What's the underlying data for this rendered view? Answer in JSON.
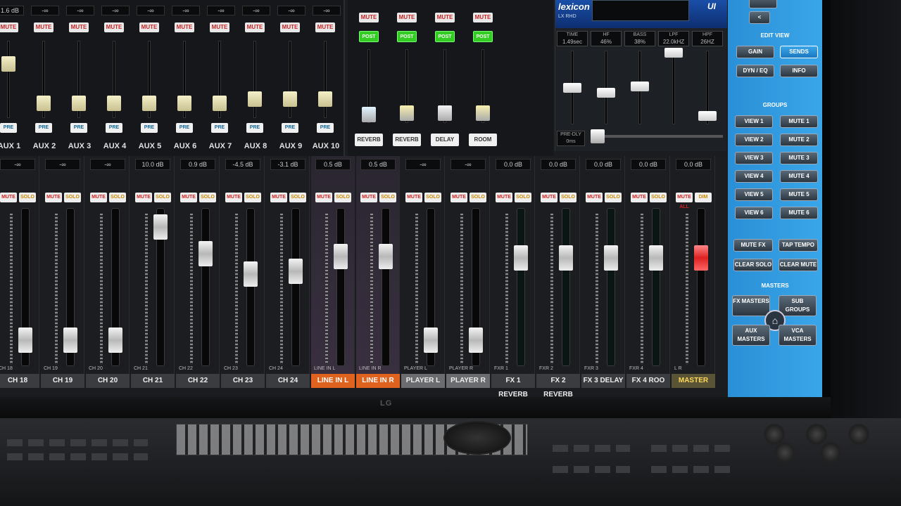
{
  "aux_section": {
    "strips": [
      {
        "value": "1.6 dB",
        "mute": "MUTE",
        "pre": "PRE",
        "name": "AUX 1"
      },
      {
        "value": "-∞",
        "mute": "MUTE",
        "pre": "PRE",
        "name": "AUX 2"
      },
      {
        "value": "-∞",
        "mute": "MUTE",
        "pre": "PRE",
        "name": "AUX 3"
      },
      {
        "value": "-∞",
        "mute": "MUTE",
        "pre": "PRE",
        "name": "AUX 4"
      },
      {
        "value": "-∞",
        "mute": "MUTE",
        "pre": "PRE",
        "name": "AUX 5"
      },
      {
        "value": "-∞",
        "mute": "MUTE",
        "pre": "PRE",
        "name": "AUX 6"
      },
      {
        "value": "-∞",
        "mute": "MUTE",
        "pre": "PRE",
        "name": "AUX 7"
      },
      {
        "value": "-∞",
        "mute": "MUTE",
        "pre": "PRE",
        "name": "AUX 8"
      },
      {
        "value": "-∞",
        "mute": "MUTE",
        "pre": "PRE",
        "name": "AUX 9"
      },
      {
        "value": "-∞",
        "mute": "MUTE",
        "pre": "PRE",
        "name": "AUX 10"
      }
    ]
  },
  "fx_section": {
    "strips": [
      {
        "mute": "MUTE",
        "post": "POST",
        "button": "REVERB"
      },
      {
        "mute": "MUTE",
        "post": "POST",
        "button": "REVERB"
      },
      {
        "mute": "MUTE",
        "post": "POST",
        "button": "DELAY"
      },
      {
        "mute": "MUTE",
        "post": "POST",
        "button": "ROOM"
      }
    ]
  },
  "lexicon": {
    "brand": "lexicon",
    "model": "LX RHD",
    "badge": "UI",
    "params": [
      {
        "name": "TIME",
        "value": "1.49sec"
      },
      {
        "name": "HF",
        "value": "46%"
      },
      {
        "name": "BASS",
        "value": "38%"
      },
      {
        "name": "LPF",
        "value": "22.0kHZ"
      },
      {
        "name": "HPF",
        "value": "26HZ"
      }
    ],
    "predelay_name": "PRE-DLY",
    "predelay_value": "0ms"
  },
  "panel": {
    "edit_view_label": "EDIT VIEW",
    "gain": "GAIN",
    "sends": "SENDS",
    "dyn_eq": "DYN / EQ",
    "info": "INFO",
    "groups_label": "GROUPS",
    "views": [
      "VIEW 1",
      "VIEW 2",
      "VIEW 3",
      "VIEW 4",
      "VIEW 5",
      "VIEW 6"
    ],
    "mutes": [
      "MUTE 1",
      "MUTE 2",
      "MUTE 3",
      "MUTE 4",
      "MUTE 5",
      "MUTE 6"
    ],
    "mute_fx": "MUTE FX",
    "tap_tempo": "TAP TEMPO",
    "clear_solo": "CLEAR SOLO",
    "clear_mute": "CLEAR MUTE",
    "masters_label": "MASTERS",
    "fx_masters": "FX MASTERS",
    "sub_groups": "SUB GROUPS",
    "aux_masters": "AUX MASTERS",
    "vca_masters": "VCA MASTERS"
  },
  "channels": [
    {
      "db": "-∞",
      "mute": "MUTE",
      "solo": "SOLO",
      "label": "CH 18",
      "name": "CH 18",
      "kind": "ch",
      "level": 0.1
    },
    {
      "db": "-∞",
      "mute": "MUTE",
      "solo": "SOLO",
      "label": "CH 19",
      "name": "CH 19",
      "kind": "ch",
      "level": 0.1
    },
    {
      "db": "-∞",
      "mute": "MUTE",
      "solo": "SOLO",
      "label": "CH 20",
      "name": "CH 20",
      "kind": "ch",
      "level": 0.1
    },
    {
      "db": "10.0 dB",
      "mute": "MUTE",
      "solo": "SOLO",
      "label": "CH 21",
      "name": "CH 21",
      "kind": "ch",
      "level": 0.95
    },
    {
      "db": "0.9 dB",
      "mute": "MUTE",
      "solo": "SOLO",
      "label": "CH 22",
      "name": "CH 22",
      "kind": "ch",
      "level": 0.75
    },
    {
      "db": "-4.5 dB",
      "mute": "MUTE",
      "solo": "SOLO",
      "label": "CH 23",
      "name": "CH 23",
      "kind": "ch",
      "level": 0.6
    },
    {
      "db": "-3.1 dB",
      "mute": "MUTE",
      "solo": "SOLO",
      "label": "CH 24",
      "name": "CH 24",
      "kind": "ch",
      "level": 0.62
    },
    {
      "db": "0.5 dB",
      "mute": "MUTE",
      "solo": "SOLO",
      "label": "LINE IN L",
      "name": "LINE IN L",
      "kind": "linein",
      "level": 0.73
    },
    {
      "db": "0.5 dB",
      "mute": "MUTE",
      "solo": "SOLO",
      "label": "LINE IN R",
      "name": "LINE IN R",
      "kind": "linein",
      "level": 0.73
    },
    {
      "db": "-∞",
      "mute": "MUTE",
      "solo": "SOLO",
      "label": "PLAYER L",
      "name": "PLAYER L",
      "kind": "player",
      "level": 0.1
    },
    {
      "db": "-∞",
      "mute": "MUTE",
      "solo": "SOLO",
      "label": "PLAYER R",
      "name": "PLAYER R",
      "kind": "player",
      "level": 0.1
    },
    {
      "db": "0.0 dB",
      "mute": "MUTE",
      "solo": "SOLO",
      "label": "FXR 1",
      "name": "FX 1 REVERB",
      "kind": "fxret",
      "level": 0.72
    },
    {
      "db": "0.0 dB",
      "mute": "MUTE",
      "solo": "SOLO",
      "label": "FXR 2",
      "name": "FX 2 REVERB",
      "kind": "fxret",
      "level": 0.72
    },
    {
      "db": "0.0 dB",
      "mute": "MUTE",
      "solo": "SOLO",
      "label": "FXR 3",
      "name": "FX 3 DELAY",
      "kind": "fxret",
      "level": 0.72
    },
    {
      "db": "0.0 dB",
      "mute": "MUTE",
      "solo": "SOLO",
      "label": "FXR 4",
      "name": "FX 4 ROO",
      "kind": "fxret",
      "level": 0.72
    },
    {
      "db": "0.0 dB",
      "mute": "MUTE ALL",
      "solo": "DIM",
      "label": "L   R",
      "name": "MASTER",
      "kind": "master",
      "level": 0.72
    }
  ],
  "monitor_brand": "LG"
}
